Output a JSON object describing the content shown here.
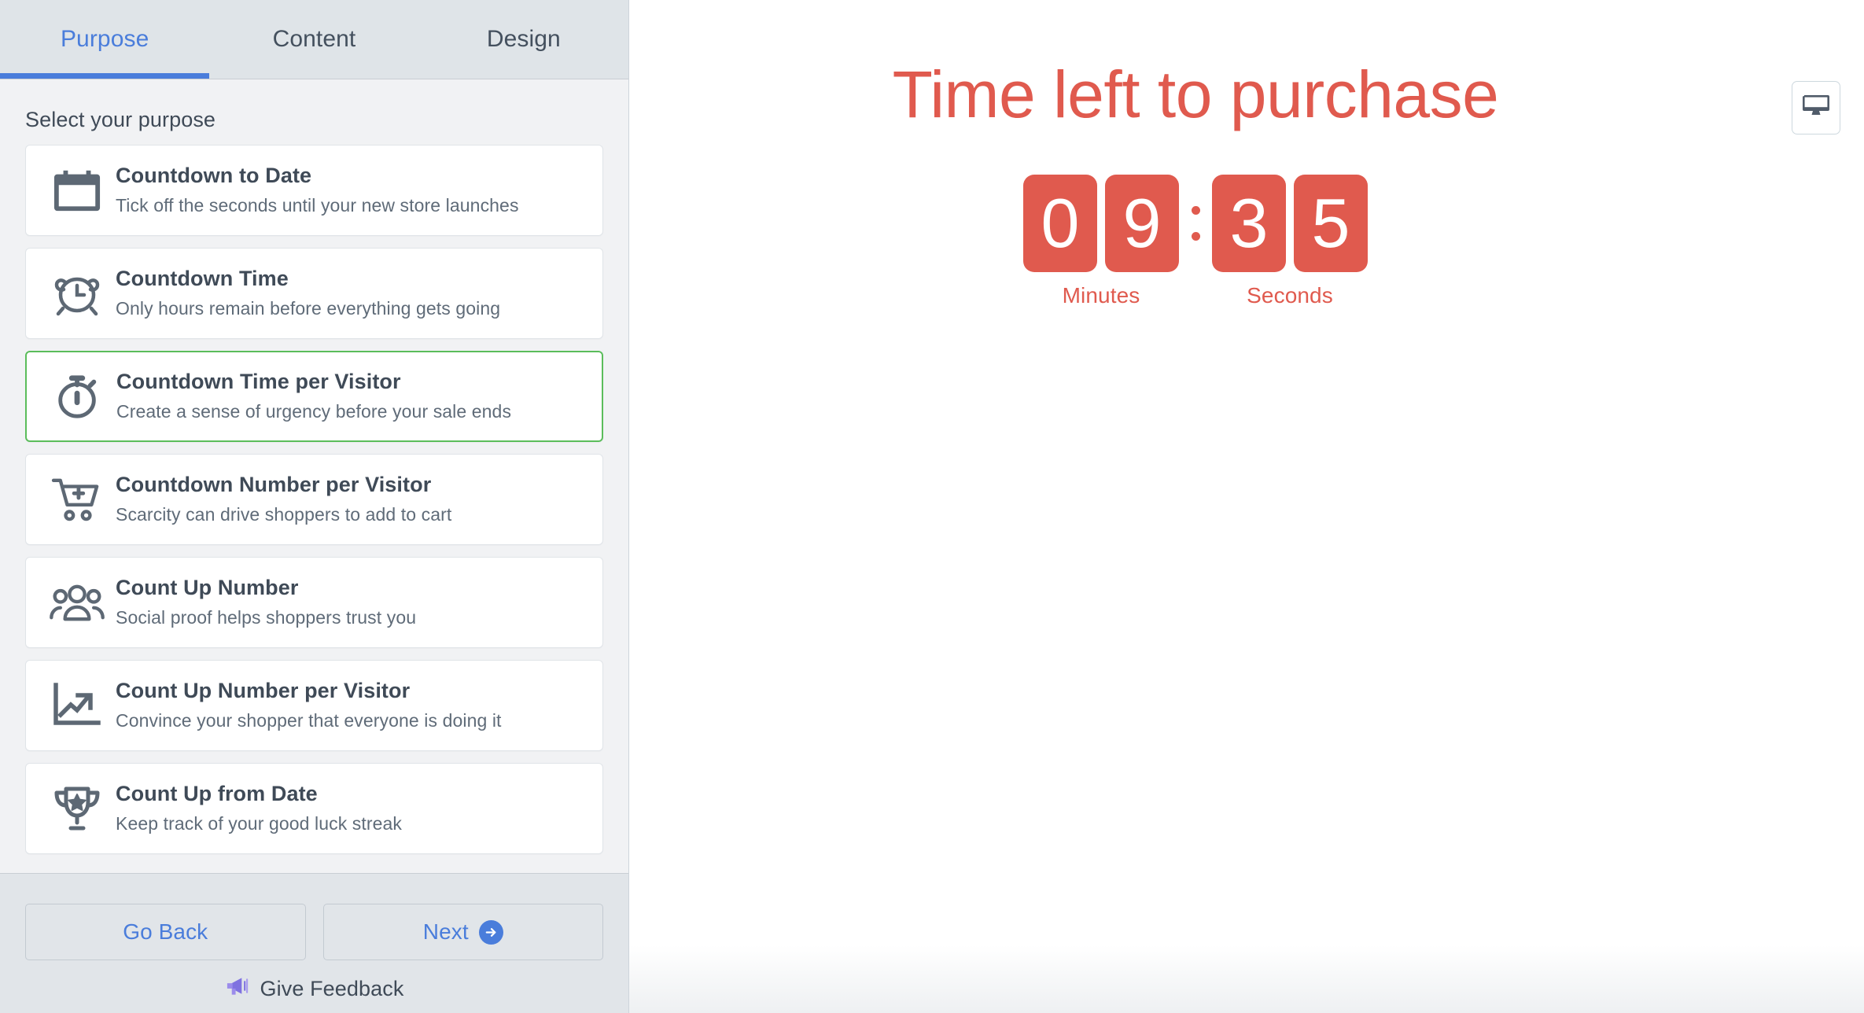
{
  "tabs": [
    {
      "label": "Purpose",
      "active": true
    },
    {
      "label": "Content",
      "active": false
    },
    {
      "label": "Design",
      "active": false
    }
  ],
  "sidebar": {
    "section_title": "Select your purpose",
    "options": [
      {
        "icon": "calendar-icon",
        "title": "Countdown to Date",
        "subtitle": "Tick off the seconds until your new store launches",
        "selected": false
      },
      {
        "icon": "alarm-clock-icon",
        "title": "Countdown Time",
        "subtitle": "Only hours remain before everything gets going",
        "selected": false
      },
      {
        "icon": "stopwatch-icon",
        "title": "Countdown Time per Visitor",
        "subtitle": "Create a sense of urgency before your sale ends",
        "selected": true
      },
      {
        "icon": "cart-plus-icon",
        "title": "Countdown Number per Visitor",
        "subtitle": "Scarcity can drive shoppers to add to cart",
        "selected": false
      },
      {
        "icon": "people-icon",
        "title": "Count Up Number",
        "subtitle": "Social proof helps shoppers trust you",
        "selected": false
      },
      {
        "icon": "trend-up-icon",
        "title": "Count Up Number per Visitor",
        "subtitle": "Convince your shopper that everyone is doing it",
        "selected": false
      },
      {
        "icon": "trophy-icon",
        "title": "Count Up from Date",
        "subtitle": "Keep track of your good luck streak",
        "selected": false
      }
    ],
    "footer": {
      "go_back_label": "Go Back",
      "next_label": "Next",
      "feedback_label": "Give Feedback"
    }
  },
  "preview": {
    "device_toggle_icon": "desktop-monitor-icon",
    "headline": "Time left to purchase",
    "countdown": {
      "minutes_digits": [
        "0",
        "9"
      ],
      "seconds_digits": [
        "3",
        "5"
      ],
      "minutes_label": "Minutes",
      "seconds_label": "Seconds",
      "separator": ":"
    }
  },
  "colors": {
    "accent_blue": "#4a7ddb",
    "selected_green": "#5bbd5b",
    "countdown_red": "#e05a4e",
    "icon_gray": "#5d6874",
    "tabbar_bg": "#dfe4e8",
    "sidebar_bg": "#f1f2f4",
    "footer_bg": "#e1e5e9",
    "feedback_purple": "#8a7ae0"
  }
}
